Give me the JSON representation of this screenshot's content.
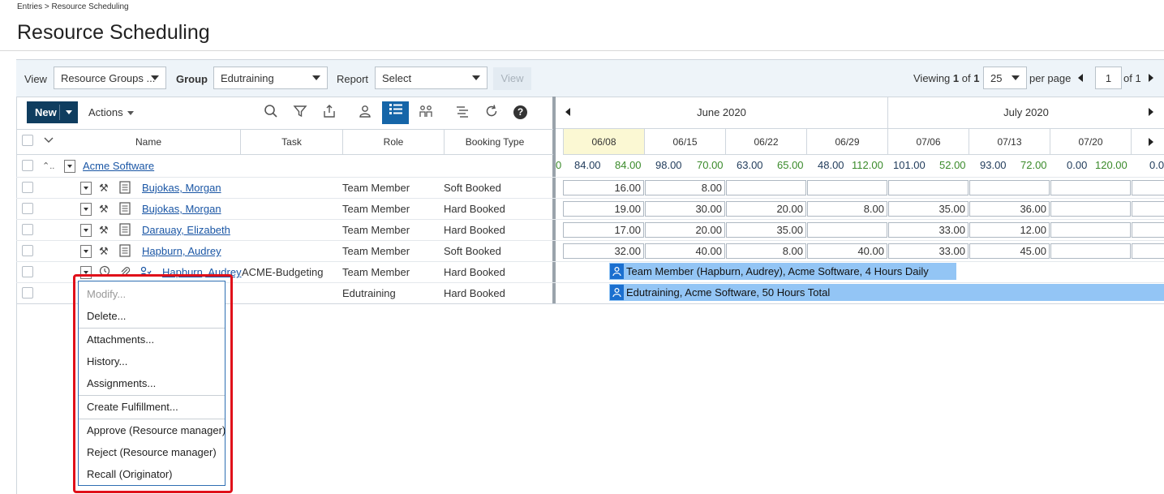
{
  "breadcrumb": "Entries > Resource Scheduling",
  "title": "Resource Scheduling",
  "toolbar": {
    "view_label": "View",
    "view_value": "Resource Groups ...",
    "group_label": "Group",
    "group_value": "Edutraining",
    "report_label": "Report",
    "report_value": "Select",
    "view_button": "View",
    "viewing_text": "Viewing",
    "viewing_cur": "1",
    "viewing_of": "of",
    "viewing_total": "1",
    "page_size": "25",
    "per_page": "per page",
    "page_num": "1",
    "page_of": "of 1"
  },
  "actions": {
    "new_label": "New",
    "actions_label": "Actions"
  },
  "columns": {
    "name": "Name",
    "task": "Task",
    "role": "Role",
    "booking_type": "Booking Type"
  },
  "calendar": {
    "months": [
      "June 2020",
      "July 2020"
    ],
    "weeks": [
      "06/08",
      "06/15",
      "06/22",
      "06/29",
      "07/06",
      "07/13",
      "07/20"
    ],
    "prev_partial_total": "0",
    "totals": [
      {
        "a": "84.00",
        "b": "84.00"
      },
      {
        "a": "98.00",
        "b": "70.00"
      },
      {
        "a": "63.00",
        "b": "65.00"
      },
      {
        "a": "48.00",
        "b": "112.00"
      },
      {
        "a": "101.00",
        "b": "52.00"
      },
      {
        "a": "93.00",
        "b": "72.00"
      },
      {
        "a": "0.00",
        "b": "120.00"
      }
    ],
    "next_partial_total": "0.0"
  },
  "rows": [
    {
      "name": "Acme Software",
      "task": "",
      "role": "",
      "booking": ""
    },
    {
      "name": "Bujokas, Morgan",
      "task": "",
      "role": "Team Member",
      "booking": "Soft Booked",
      "hours": [
        "16.00",
        "8.00",
        "",
        "",
        "",
        "",
        ""
      ]
    },
    {
      "name": "Bujokas, Morgan",
      "task": "",
      "role": "Team Member",
      "booking": "Hard Booked",
      "hours": [
        "19.00",
        "30.00",
        "20.00",
        "8.00",
        "35.00",
        "36.00",
        ""
      ]
    },
    {
      "name": "Darauay, Elizabeth",
      "task": "",
      "role": "Team Member",
      "booking": "Hard Booked",
      "hours": [
        "17.00",
        "20.00",
        "35.00",
        "",
        "33.00",
        "12.00",
        ""
      ]
    },
    {
      "name": "Hapburn, Audrey",
      "task": "",
      "role": "Team Member",
      "booking": "Soft Booked",
      "hours": [
        "32.00",
        "40.00",
        "8.00",
        "40.00",
        "33.00",
        "45.00",
        ""
      ]
    },
    {
      "name": "Hapburn, Audrey",
      "task": "ACME-Budgeting",
      "role": "Team Member",
      "booking": "Hard Booked"
    },
    {
      "name": "",
      "task": "",
      "role": "Edutraining",
      "booking": "Hard Booked"
    }
  ],
  "bars": [
    "Team Member (Hapburn, Audrey), Acme Software, 4 Hours Daily",
    "Edutraining, Acme Software, 50 Hours Total"
  ],
  "context_menu": {
    "modify": "Modify...",
    "delete": "Delete...",
    "attachments": "Attachments...",
    "history": "History...",
    "assignments": "Assignments...",
    "create_fulfillment": "Create Fulfillment...",
    "approve": "Approve (Resource manager)",
    "reject": "Reject (Resource manager)",
    "recall": "Recall (Originator)"
  },
  "colors": {
    "primary": "#0f3d5f",
    "accent": "#1565a8",
    "bar": "#93c5f5",
    "highlight": "#e0101a",
    "total_green": "#3a8a2a"
  }
}
